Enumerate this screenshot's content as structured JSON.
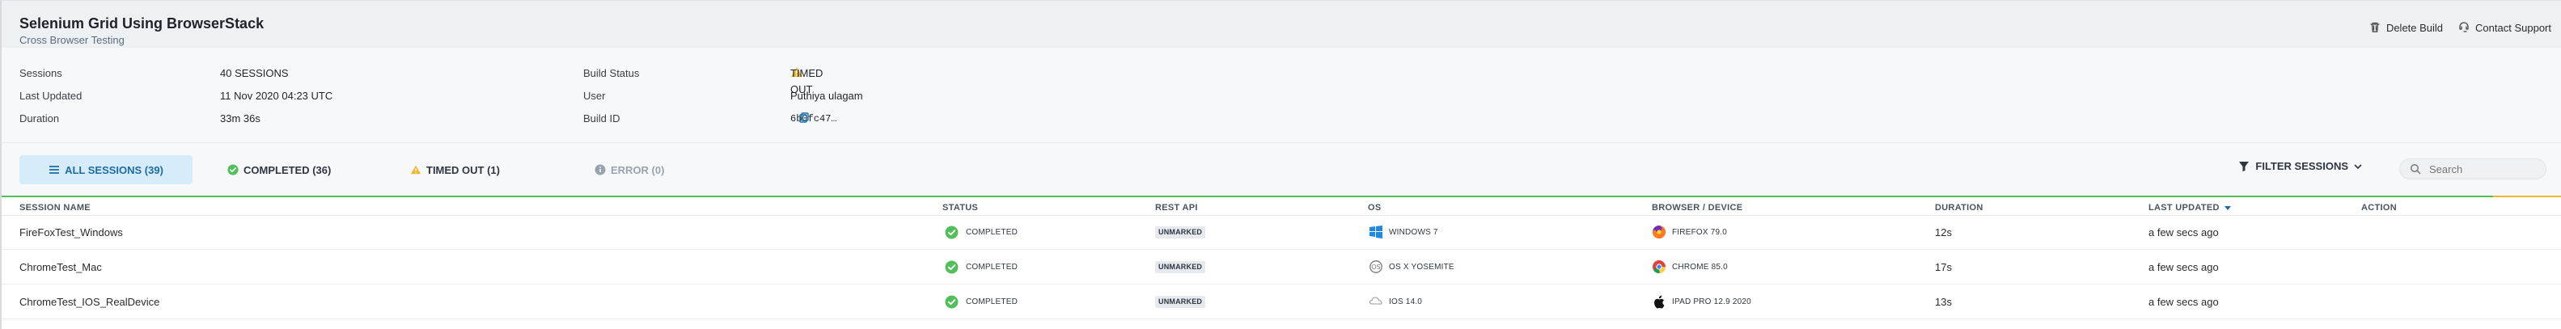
{
  "header": {
    "title": "Selenium Grid Using BrowserStack",
    "subtitle": "Cross Browser Testing",
    "actions": {
      "delete": "Delete Build",
      "support": "Contact Support"
    }
  },
  "summary": {
    "sessions_label": "Sessions",
    "sessions_value": "40  SESSIONS",
    "last_updated_label": "Last Updated",
    "last_updated_value": "11 Nov 2020 04:23 UTC",
    "duration_label": "Duration",
    "duration_value": "33m 36s",
    "build_status_label": "Build Status",
    "build_status_value": "TIMED OUT",
    "user_label": "User",
    "user_value": "Puthiya ulagam",
    "build_id_label": "Build ID",
    "build_id_value": "6b0fc47…"
  },
  "tabs": {
    "all": "ALL SESSIONS (39)",
    "completed": "COMPLETED (36)",
    "timed_out": "TIMED OUT (1)",
    "error": "ERROR (0)"
  },
  "toolbar": {
    "filter": "FILTER SESSIONS",
    "search_placeholder": "Search"
  },
  "table": {
    "headers": {
      "name": "SESSION NAME",
      "status": "STATUS",
      "rest_api": "REST API",
      "os": "OS",
      "browser": "BROWSER / DEVICE",
      "duration": "DURATION",
      "last_updated": "LAST UPDATED",
      "action": "ACTION"
    },
    "rows": [
      {
        "name": "FireFoxTest_Windows",
        "status": "COMPLETED",
        "rest_api": "UNMARKED",
        "os": "WINDOWS 7",
        "browser": "FIREFOX 79.0",
        "duration": "12s",
        "last_updated": "a few secs ago"
      },
      {
        "name": "ChromeTest_Mac",
        "status": "COMPLETED",
        "rest_api": "UNMARKED",
        "os": "OS X YOSEMITE",
        "browser": "CHROME 85.0",
        "duration": "17s",
        "last_updated": "a few secs ago"
      },
      {
        "name": "ChromeTest_IOS_RealDevice",
        "status": "COMPLETED",
        "rest_api": "UNMARKED",
        "os": "IOS 14.0",
        "browser": "IPAD PRO 12.9 2020",
        "duration": "13s",
        "last_updated": "a few secs ago"
      }
    ]
  },
  "colors": {
    "accent": "#1c6ca5",
    "success": "#51c05a",
    "warning": "#f2b62f"
  },
  "icons": {
    "delete": "trash-icon",
    "support": "support-icon",
    "all_sessions": "list-icon",
    "completed": "check-circle-icon",
    "timed_out": "warning-icon",
    "error": "info-icon",
    "filter": "filter-icon",
    "search": "search-icon",
    "copy": "copy-icon",
    "windows": "windows-icon",
    "macos": "macos-icon",
    "ios": "ios-icon",
    "firefox": "firefox-icon",
    "chrome": "chrome-icon",
    "apple": "apple-icon"
  }
}
